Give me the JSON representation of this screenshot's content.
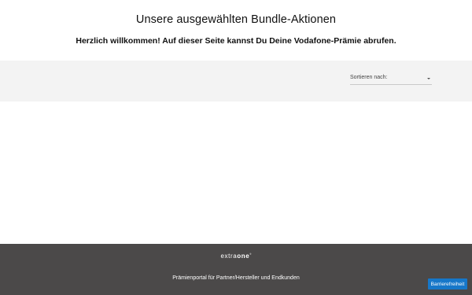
{
  "header": {
    "title": "Unsere ausgewählten Bundle-Aktionen",
    "subtitle": "Herzlich willkommen! Auf dieser Seite kannst Du Deine Vodafone-Prämie abrufen."
  },
  "filter": {
    "sort_label": "Sortieren nach:",
    "sort_value": ""
  },
  "footer": {
    "logo_part1": "extra",
    "logo_part2": "one",
    "tagline": "Prämienportal für Partner/Hersteller und Endkunden",
    "accessibility_button": "Barrierefreiheit",
    "accessibility_button_color": "#1677c9",
    "background_color": "#4b4949"
  },
  "icons": {
    "sort_dropdown": "chevron-down-icon"
  }
}
